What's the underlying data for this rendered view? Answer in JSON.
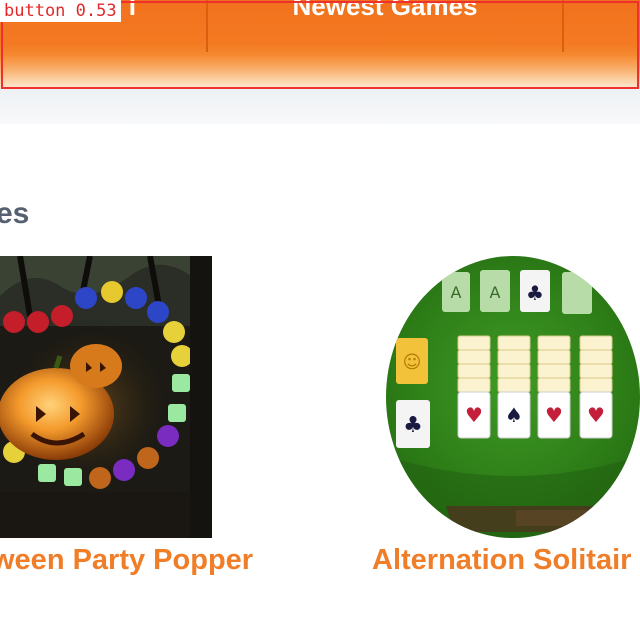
{
  "navbar": {
    "tabs": [
      {
        "label": "I"
      },
      {
        "label": "Newest Games"
      },
      {
        "label": ""
      }
    ]
  },
  "section": {
    "title": "es"
  },
  "games": [
    {
      "title": "ween Party Popper"
    },
    {
      "title": "Alternation Solitair"
    }
  ],
  "detection": {
    "label": "button 0.53"
  },
  "colors": {
    "nav_orange": "#f2711c",
    "title_orange": "#f07d28",
    "heading_gray": "#556070",
    "detect_red": "#ee3030"
  }
}
